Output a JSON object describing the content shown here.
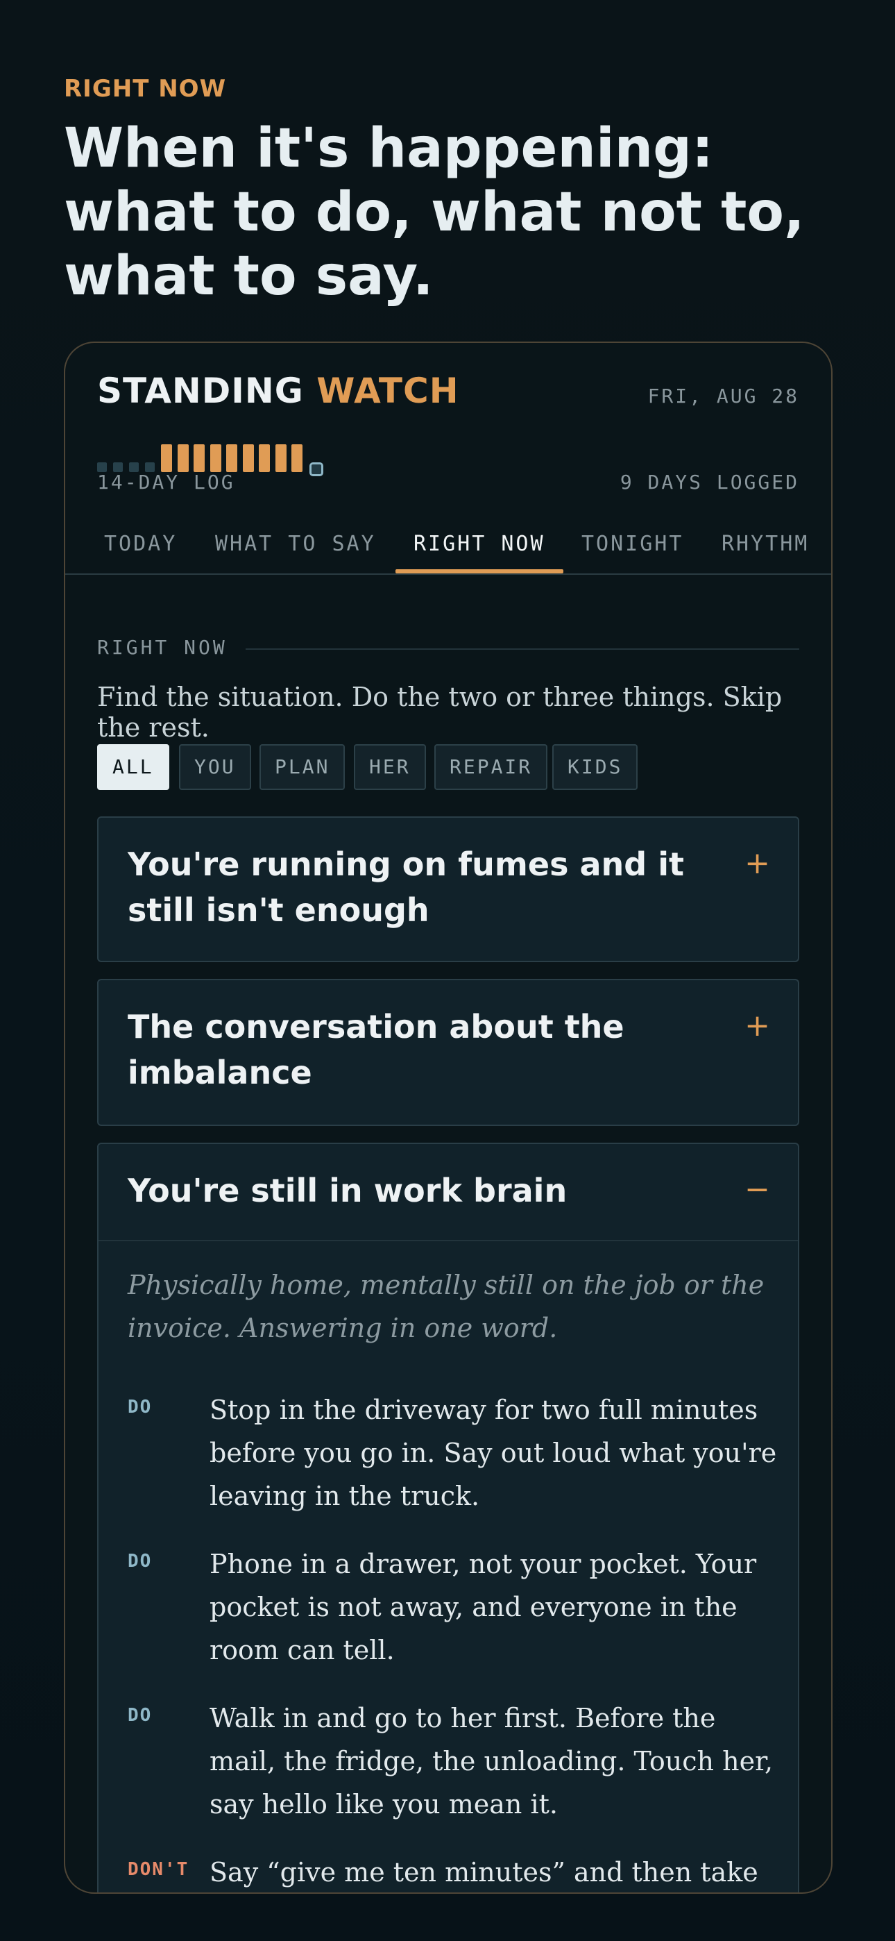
{
  "hero": {
    "eyebrow": "RIGHT NOW",
    "title_line1": "When it's happening:",
    "title_line2": "what to do, what not to,",
    "title_line3": "what to say."
  },
  "card": {
    "brand_main": "STANDING",
    "brand_accent": "WATCH",
    "date": "FRI, AUG 28",
    "log": {
      "label": "14-DAY LOG",
      "count_label": "9 DAYS LOGGED",
      "days": [
        "empty",
        "empty",
        "empty",
        "empty",
        "logged",
        "logged",
        "logged",
        "logged",
        "logged",
        "logged",
        "logged",
        "logged",
        "logged",
        "today"
      ]
    },
    "tabs": [
      "TODAY",
      "WHAT TO SAY",
      "RIGHT NOW",
      "TONIGHT",
      "RHYTHM"
    ],
    "active_tab": "RIGHT NOW",
    "section_label": "RIGHT NOW",
    "intro": "Find the situation. Do the two or three things. Skip the rest.",
    "filters": [
      "ALL",
      "YOU",
      "PLAN",
      "HER",
      "REPAIR",
      "KIDS"
    ],
    "active_filter": "ALL",
    "situations": [
      {
        "title": "You're running on fumes and it still isn't enough",
        "toggle": "+"
      },
      {
        "title": "The conversation about the imbalance",
        "toggle": "+"
      },
      {
        "title": "You're still in work brain",
        "toggle": "−",
        "description": "Physically home, mentally still on the job or the invoice. Answering in one word.",
        "items": [
          {
            "tag": "DO",
            "text": "Stop in the driveway for two full minutes before you go in. Say out loud what you're leaving in the truck."
          },
          {
            "tag": "DO",
            "text": "Phone in a drawer, not your pocket. Your pocket is not away, and everyone in the room can tell."
          },
          {
            "tag": "DO",
            "text": "Walk in and go to her first. Before the mail, the fridge, the unloading. Touch her, say hello like you mean it."
          },
          {
            "tag": "DON'T",
            "text": "Say “give me ten minutes” and then take"
          }
        ]
      }
    ]
  },
  "colors": {
    "accent": "#e09c55",
    "background": "#0a1418",
    "do_tag": "#8fb8c8",
    "dont_tag": "#e68a6a"
  }
}
